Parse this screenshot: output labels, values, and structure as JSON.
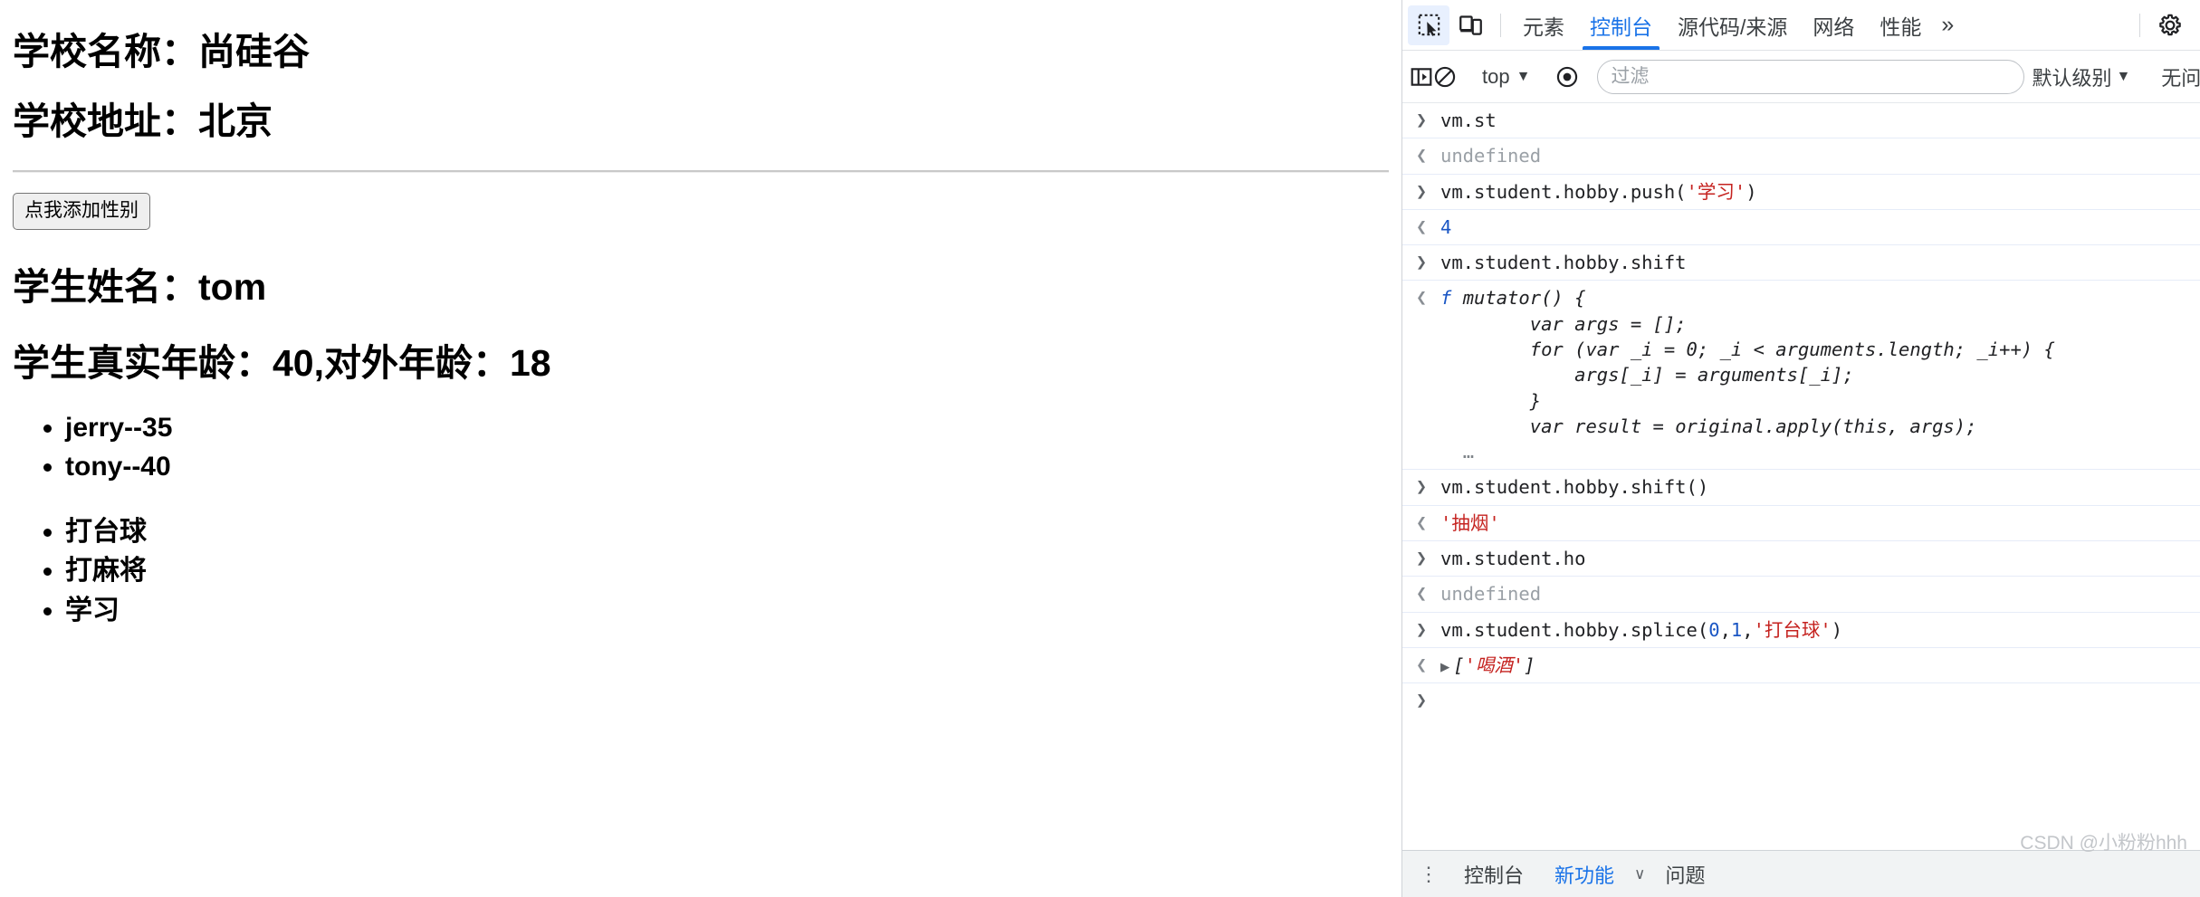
{
  "page": {
    "school_name_line": "学校名称：尚硅谷",
    "school_address_line": "学校地址：北京",
    "add_gender_button": "点我添加性别",
    "student_name_line": "学生姓名：tom",
    "student_age_line": "学生真实年龄：40,对外年龄：18",
    "friends": [
      "jerry--35",
      "tony--40"
    ],
    "hobbies": [
      "打台球",
      "打麻将",
      "学习"
    ]
  },
  "devtools": {
    "tabs": [
      {
        "label": "元素",
        "active": false
      },
      {
        "label": "控制台",
        "active": true
      },
      {
        "label": "源代码/来源",
        "active": false
      },
      {
        "label": "网络",
        "active": false
      },
      {
        "label": "性能",
        "active": false
      }
    ],
    "more_tabs_label": "»",
    "icons": {
      "inspect": "inspect-element-icon",
      "device": "device-toolbar-icon",
      "settings": "gear-icon",
      "sidebar": "console-sidebar-icon",
      "clear": "clear-console-icon",
      "eye": "live-expression-icon"
    },
    "toolbar": {
      "context": "top",
      "filter_placeholder": "过滤",
      "filter_value": "",
      "level": "默认级别",
      "issues": "无问题",
      "dropdown_caret": "▼"
    },
    "accent_color": "#1a73e8",
    "string_color": "#c5221f",
    "number_color": "#1a56c4",
    "console_rows": [
      {
        "kind": "input",
        "marker": "❯",
        "parts": [
          {
            "t": "vm.st",
            "cls": ""
          }
        ]
      },
      {
        "kind": "output",
        "marker": "❮",
        "parts": [
          {
            "t": "undefined",
            "cls": "t-undef"
          }
        ]
      },
      {
        "kind": "input",
        "marker": "❯",
        "parts": [
          {
            "t": "vm.student.hobby.push(",
            "cls": ""
          },
          {
            "t": "'学习'",
            "cls": "t-str"
          },
          {
            "t": ")",
            "cls": ""
          }
        ]
      },
      {
        "kind": "output",
        "marker": "❮",
        "parts": [
          {
            "t": "4",
            "cls": "t-num"
          }
        ]
      },
      {
        "kind": "input",
        "marker": "❯",
        "parts": [
          {
            "t": "vm.student.hobby.shift",
            "cls": ""
          }
        ]
      },
      {
        "kind": "output",
        "marker": "❮",
        "parts": [
          {
            "t": "f ",
            "cls": "t-fn"
          },
          {
            "t": "mutator() {\n        var args = [];\n        for (var _i = 0; _i < arguments.length; _i++) {\n            args[_i] = arguments[_i];\n        }\n        var result = original.apply(this, args);",
            "cls": "t-italic"
          },
          {
            "t": "\n  …",
            "cls": "t-grey"
          }
        ]
      },
      {
        "kind": "input",
        "marker": "❯",
        "parts": [
          {
            "t": "vm.student.hobby.shift()",
            "cls": ""
          }
        ]
      },
      {
        "kind": "output",
        "marker": "❮",
        "parts": [
          {
            "t": "'抽烟'",
            "cls": "t-str"
          }
        ]
      },
      {
        "kind": "input",
        "marker": "❯",
        "parts": [
          {
            "t": "vm.student.ho",
            "cls": ""
          }
        ]
      },
      {
        "kind": "output",
        "marker": "❮",
        "parts": [
          {
            "t": "undefined",
            "cls": "t-undef"
          }
        ]
      },
      {
        "kind": "input",
        "marker": "❯",
        "parts": [
          {
            "t": "vm.student.hobby.splice(",
            "cls": ""
          },
          {
            "t": "0",
            "cls": "t-num"
          },
          {
            "t": ",",
            "cls": ""
          },
          {
            "t": "1",
            "cls": "t-num"
          },
          {
            "t": ",",
            "cls": ""
          },
          {
            "t": "'打台球'",
            "cls": "t-str"
          },
          {
            "t": ")",
            "cls": ""
          }
        ]
      },
      {
        "kind": "output",
        "marker": "❮",
        "expandable": true,
        "parts": [
          {
            "t": "[",
            "cls": "t-italic"
          },
          {
            "t": "'喝酒'",
            "cls": "t-str t-italic"
          },
          {
            "t": "]",
            "cls": "t-italic"
          }
        ]
      },
      {
        "kind": "prompt",
        "marker": "❯",
        "parts": [
          {
            "t": "",
            "cls": ""
          }
        ]
      }
    ],
    "drawer": {
      "tabs": [
        {
          "label": "控制台",
          "active": false
        },
        {
          "label": "新功能",
          "active": true,
          "caret": "∨"
        },
        {
          "label": "问题",
          "active": false
        }
      ]
    },
    "watermark": "CSDN @小粉粉hhh"
  }
}
